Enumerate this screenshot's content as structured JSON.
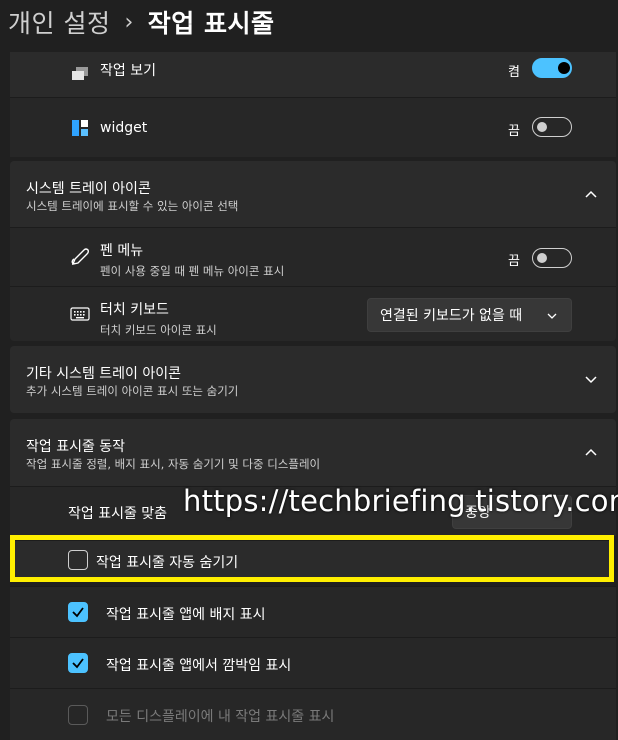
{
  "header": {
    "parent": "개인 설정",
    "separator": "›",
    "current": "작업 표시줄"
  },
  "top_items": [
    {
      "label": "작업 보기",
      "state": "켬",
      "on": true,
      "icon": "task-view-icon"
    },
    {
      "label": "widget",
      "state": "끔",
      "on": false,
      "icon": "widgets-icon"
    }
  ],
  "tray": {
    "title": "시스템 트레이 아이콘",
    "subtitle": "시스템 트레이에 표시할 수 있는 아이콘 선택",
    "pen": {
      "title": "펜 메뉴",
      "subtitle": "펜이 사용 중일 때 펜 메뉴 아이콘 표시",
      "state": "끔",
      "on": false
    },
    "touch": {
      "title": "터치 키보드",
      "subtitle": "터치 키보드 아이콘 표시",
      "value": "연결된 키보드가 없을 때"
    }
  },
  "other_tray": {
    "title": "기타 시스템 트레이 아이콘",
    "subtitle": "추가 시스템 트레이 아이콘 표시 또는 숨기기"
  },
  "behavior": {
    "title": "작업 표시줄 동작",
    "subtitle": "작업 표시줄 정렬, 배지 표시, 자동 숨기기 및 다중 디스플레이",
    "alignment_label": "작업 표시줄 맞춤",
    "alignment_value": "중앙",
    "auto_hide": {
      "label": "작업 표시줄 자동 숨기기",
      "checked": false
    },
    "badges": {
      "label": "작업 표시줄 앱에 배지 표시",
      "checked": true
    },
    "flashing": {
      "label": "작업 표시줄 앱에서 깜박임 표시",
      "checked": true
    },
    "all_displays": {
      "label": "모든 디스플레이에 내 작업 표시줄 표시",
      "checked": false,
      "disabled": true
    }
  },
  "watermark": "https://techbriefing.tistory.com",
  "colors": {
    "accent": "#4cc2ff",
    "highlight": "#ffef00",
    "background": "#202020",
    "card": "#2b2b2b"
  }
}
